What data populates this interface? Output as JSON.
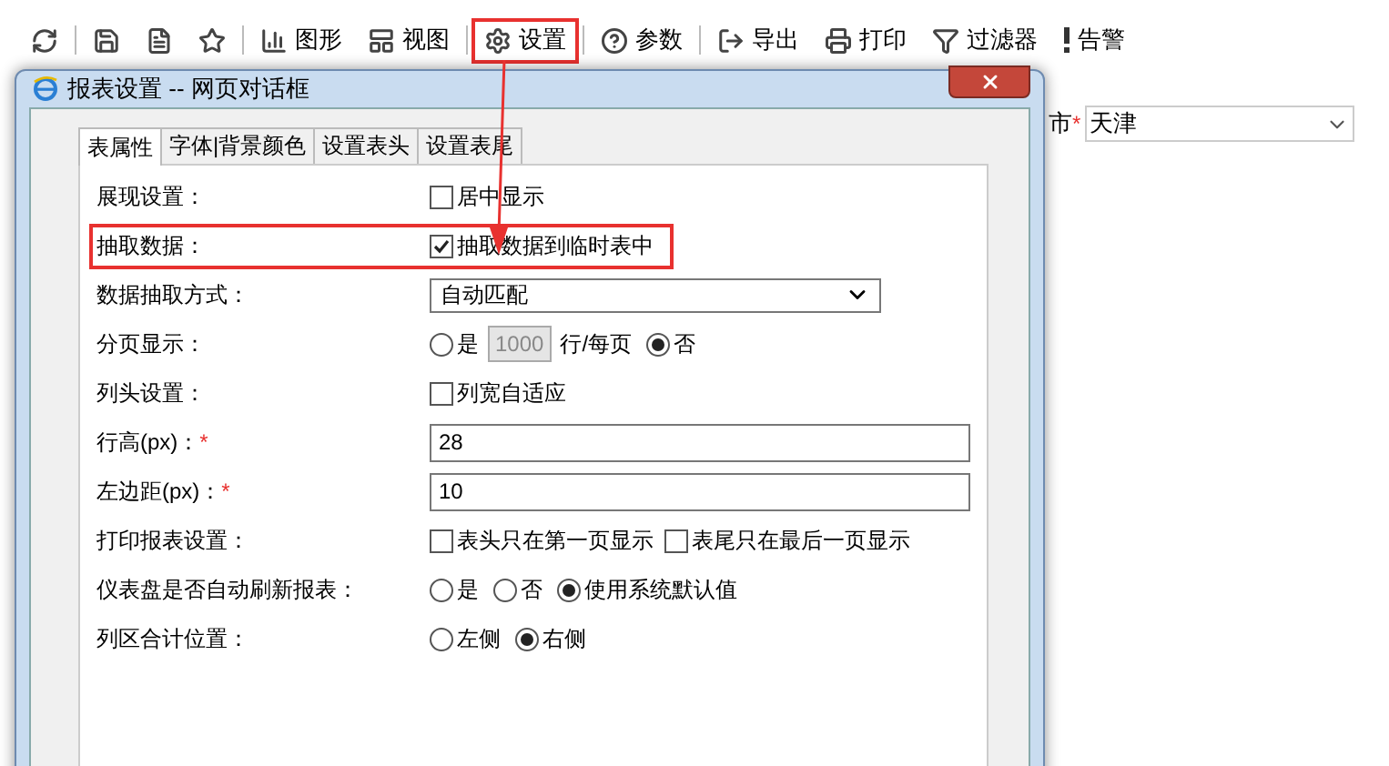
{
  "toolbar": [
    {
      "highlighted": false
    },
    {
      "highlighted": false
    },
    {
      "highlighted": false
    },
    {
      "highlighted": false
    },
    {
      "label": "图形",
      "highlighted": false
    },
    {
      "label": "视图",
      "highlighted": false
    },
    {
      "label": "设置",
      "highlighted": true
    },
    {
      "label": "参数",
      "highlighted": false
    },
    {
      "label": "导出",
      "highlighted": false
    },
    {
      "label": "打印",
      "highlighted": false
    },
    {
      "label": "过滤器",
      "highlighted": false
    },
    {
      "label": "告警",
      "highlighted": false
    }
  ],
  "background_field": {
    "label": "市",
    "required_mark": "*",
    "value": "天津"
  },
  "dialog": {
    "title": "报表设置 -- 网页对话框",
    "tabs": [
      {
        "label": "表属性",
        "selected": true
      },
      {
        "label": "字体|背景颜色",
        "selected": false
      },
      {
        "label": "设置表头",
        "selected": false
      },
      {
        "label": "设置表尾",
        "selected": false
      }
    ],
    "rows": [
      {
        "label": "展现设置：",
        "kind": "checkboxes",
        "highlighted": false,
        "options": [
          {
            "label": "居中显示",
            "checked": false
          }
        ]
      },
      {
        "label": "抽取数据：",
        "kind": "checkboxes",
        "highlighted": true,
        "options": [
          {
            "label": "抽取数据到临时表中",
            "checked": true
          }
        ]
      },
      {
        "label": "数据抽取方式：",
        "kind": "select",
        "highlighted": false,
        "value": "自动匹配"
      },
      {
        "label": "分页显示：",
        "kind": "paging",
        "highlighted": false,
        "options": [
          {
            "label": "是",
            "selected": false
          },
          {
            "label": "否",
            "selected": true
          }
        ],
        "page_size": {
          "value": "1000",
          "disabled": true
        },
        "unit": "行/每页"
      },
      {
        "label": "列头设置：",
        "kind": "checkboxes",
        "highlighted": false,
        "options": [
          {
            "label": "列宽自适应",
            "checked": false
          }
        ]
      },
      {
        "label": "行高(px)：",
        "required_mark": "*",
        "kind": "input",
        "highlighted": false,
        "value": "28"
      },
      {
        "label": "左边距(px)：",
        "required_mark": "*",
        "kind": "input",
        "highlighted": false,
        "value": "10"
      },
      {
        "label": "打印报表设置：",
        "kind": "checkboxes",
        "highlighted": false,
        "options": [
          {
            "label": "表头只在第一页显示",
            "checked": false
          },
          {
            "label": "表尾只在最后一页显示",
            "checked": false
          }
        ]
      },
      {
        "label": "仪表盘是否自动刷新报表：",
        "kind": "radios",
        "highlighted": false,
        "options": [
          {
            "label": "是",
            "selected": false
          },
          {
            "label": "否",
            "selected": false
          },
          {
            "label": "使用系统默认值",
            "selected": true
          }
        ]
      },
      {
        "label": "列区合计位置：",
        "kind": "radios",
        "highlighted": false,
        "options": [
          {
            "label": "左侧",
            "selected": false
          },
          {
            "label": "右侧",
            "selected": true
          }
        ]
      }
    ]
  }
}
